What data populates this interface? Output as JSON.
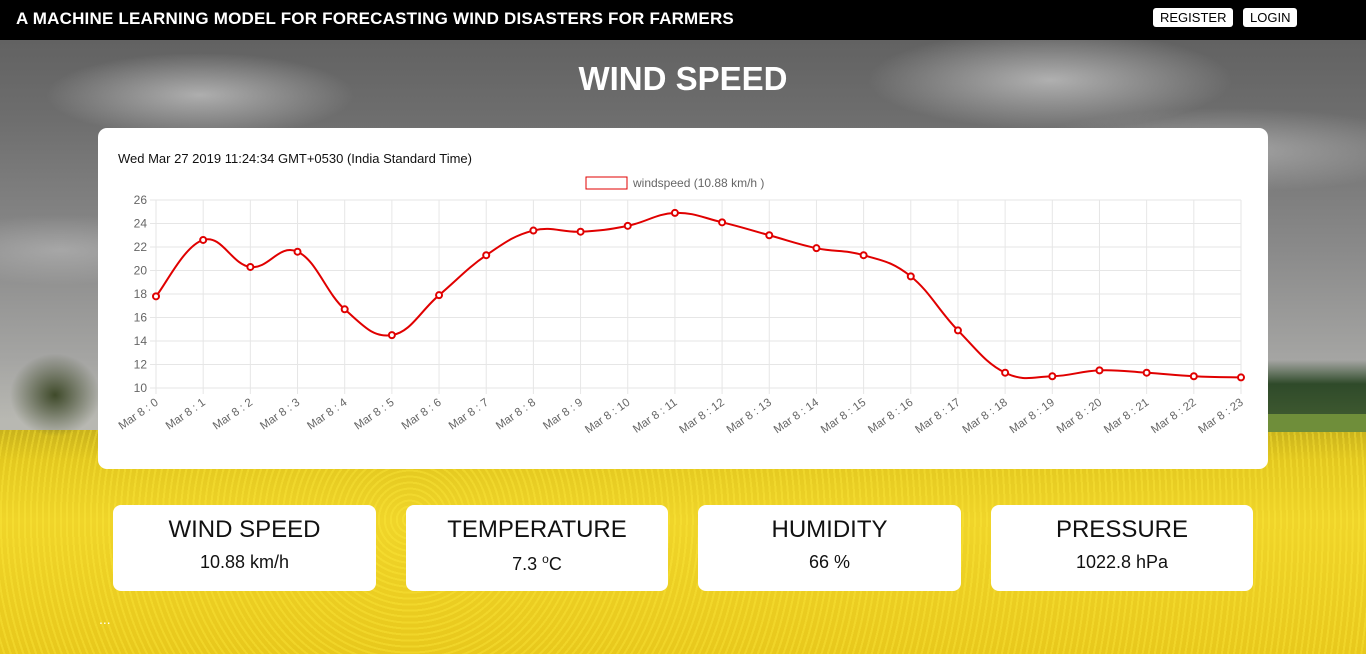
{
  "navbar": {
    "title": "A MACHINE LEARNING MODEL FOR FORECASTING WIND DISASTERS FOR FARMERS",
    "register_label": "REGISTER",
    "login_label": "LOGIN"
  },
  "page": {
    "heading": "WIND SPEED",
    "ellipsis": "..."
  },
  "chart_card": {
    "timestamp": "Wed Mar 27 2019 11:24:34 GMT+0530 (India Standard Time)"
  },
  "chart_data": {
    "type": "line",
    "categories": [
      "Mar 8 : 0",
      "Mar 8 : 1",
      "Mar 8 : 2",
      "Mar 8 : 3",
      "Mar 8 : 4",
      "Mar 8 : 5",
      "Mar 8 : 6",
      "Mar 8 : 7",
      "Mar 8 : 8",
      "Mar 8 : 9",
      "Mar 8 : 10",
      "Mar 8 : 11",
      "Mar 8 : 12",
      "Mar 8 : 13",
      "Mar 8 : 14",
      "Mar 8 : 15",
      "Mar 8 : 16",
      "Mar 8 : 17",
      "Mar 8 : 18",
      "Mar 8 : 19",
      "Mar 8 : 20",
      "Mar 8 : 21",
      "Mar 8 : 22",
      "Mar 8 : 23"
    ],
    "series": [
      {
        "name": "windspeed (10.88 km/h )",
        "color": "#e00000",
        "values": [
          17.8,
          22.6,
          20.3,
          21.6,
          16.7,
          14.5,
          17.9,
          21.3,
          23.4,
          23.3,
          23.8,
          24.9,
          24.1,
          23.0,
          21.9,
          21.3,
          19.5,
          14.9,
          11.3,
          11.0,
          11.5,
          11.3,
          11.0,
          10.9
        ]
      }
    ],
    "y_ticks": [
      10,
      12,
      14,
      16,
      18,
      20,
      22,
      24,
      26
    ],
    "ylim": [
      10,
      26
    ],
    "grid": true,
    "legend_position": "top-center"
  },
  "stats": {
    "wind": {
      "title": "WIND SPEED",
      "value": "10.88 km/h"
    },
    "temperature": {
      "title": "TEMPERATURE",
      "value": "7.3 ",
      "unit_sup": "o",
      "unit": "C"
    },
    "humidity": {
      "title": "HUMIDITY",
      "value": "66 %"
    },
    "pressure": {
      "title": "PRESSURE",
      "value": "1022.8 hPa"
    }
  }
}
